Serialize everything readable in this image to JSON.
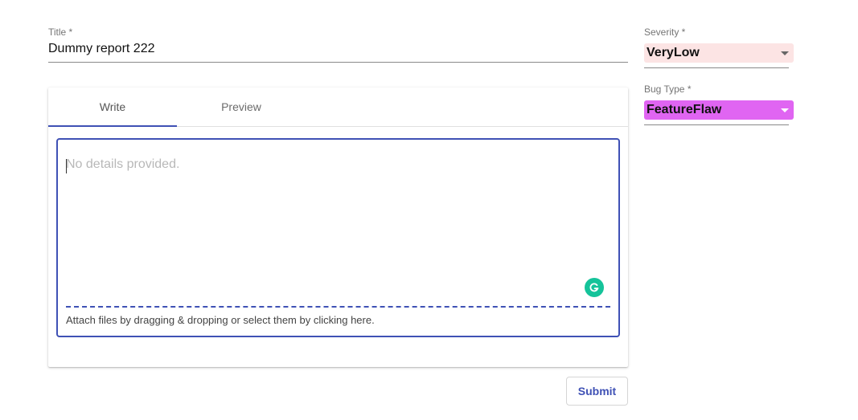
{
  "form": {
    "title_label": "Title *",
    "title_value": "Dummy report 222"
  },
  "editor": {
    "tabs": [
      {
        "label": "Write",
        "active": true
      },
      {
        "label": "Preview",
        "active": false
      }
    ],
    "placeholder": "No details provided.",
    "attach_hint": "Attach files by dragging & dropping or select them by clicking here."
  },
  "severity": {
    "label": "Severity *",
    "value": "VeryLow",
    "color": "#fce4e4"
  },
  "bug_type": {
    "label": "Bug Type *",
    "value": "FeatureFlaw",
    "color": "#e065f2"
  },
  "actions": {
    "submit_label": "Submit"
  },
  "icons": {
    "grammarly": "grammarly-icon",
    "dropdown": "chevron-down-icon"
  }
}
